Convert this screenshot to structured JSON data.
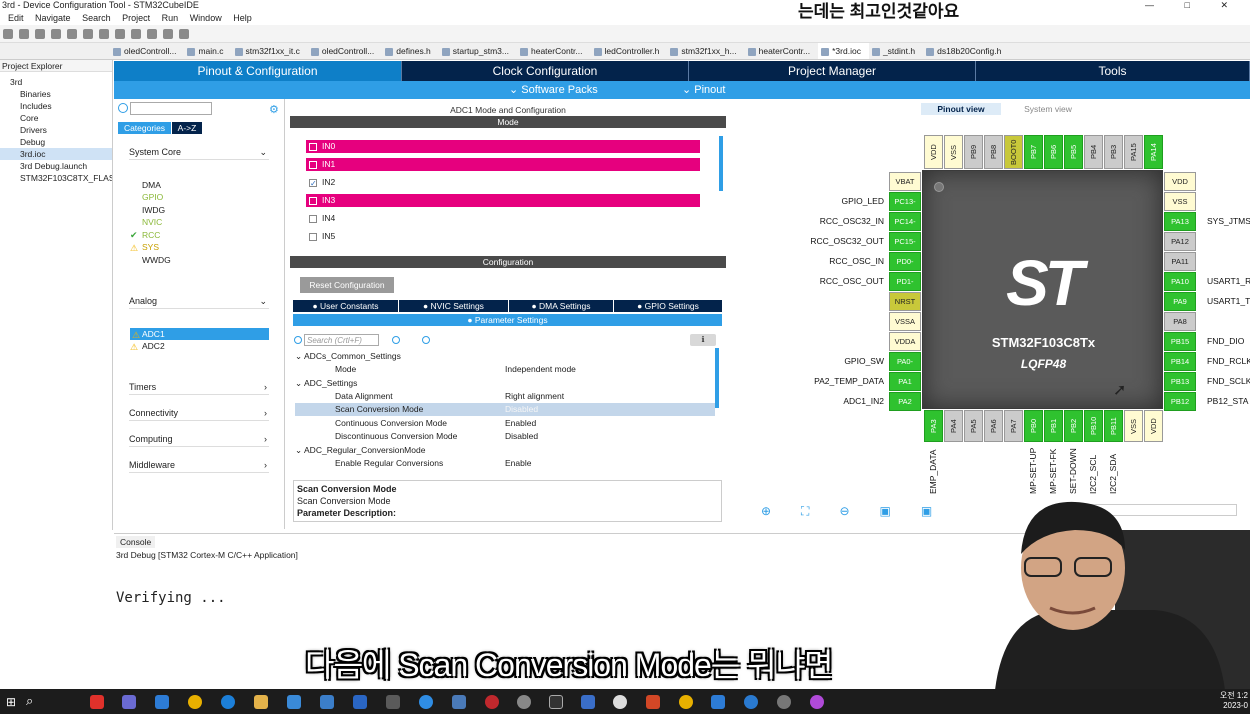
{
  "window": {
    "title": "3rd - Device Configuration Tool - STM32CubeIDE",
    "controls": "— □ ✕"
  },
  "subtitle_top": "는데는 최고인것같아요",
  "subtitle_bottom": "다음에 Scan Conversion Mode는 뭐냐면",
  "menu": [
    "Edit",
    "Navigate",
    "Search",
    "Project",
    "Run",
    "Window",
    "Help"
  ],
  "editor_tabs": [
    "oledControll...",
    "main.c",
    "stm32f1xx_it.c",
    "oledControll...",
    "defines.h",
    "startup_stm3...",
    "heaterContr...",
    "ledController.h",
    "stm32f1xx_h...",
    "heaterContr...",
    "*3rd.ioc",
    "_stdint.h",
    "ds18b20Config.h"
  ],
  "project_explorer": {
    "title": "Project Explorer",
    "items": [
      "3rd",
      "Binaries",
      "Includes",
      "Core",
      "Drivers",
      "Debug",
      "3rd.ioc",
      "3rd Debug.launch",
      "STM32F103C8TX_FLASH"
    ]
  },
  "main_tabs": [
    "Pinout & Configuration",
    "Clock Configuration",
    "Project Manager",
    "Tools"
  ],
  "sub_tabs": [
    "Software Packs",
    "Pinout"
  ],
  "categories": {
    "tab_categories": "Categories",
    "tab_az": "A->Z",
    "system_core": "System Core",
    "system_items": [
      "DMA",
      "GPIO",
      "IWDG",
      "NVIC",
      "RCC",
      "SYS",
      "WWDG"
    ],
    "analog": "Analog",
    "analog_items": [
      "ADC1",
      "ADC2"
    ],
    "sections": [
      "Timers",
      "Connectivity",
      "Computing",
      "Middleware"
    ]
  },
  "mode": {
    "title": "ADC1 Mode and Configuration",
    "header": "Mode",
    "inputs": [
      {
        "label": "IN0",
        "on": true
      },
      {
        "label": "IN1",
        "on": true
      },
      {
        "label": "IN2",
        "on": false,
        "checked": true
      },
      {
        "label": "IN3",
        "on": true
      },
      {
        "label": "IN4",
        "on": false
      },
      {
        "label": "IN5",
        "on": false
      }
    ]
  },
  "config": {
    "header": "Configuration",
    "reset_button": "Reset Configuration",
    "tabs": [
      "User Constants",
      "NVIC Settings",
      "DMA Settings",
      "GPIO Settings"
    ],
    "param_tab": "Parameter Settings",
    "search_placeholder": "Search (Crtl+F)",
    "params": [
      {
        "k": "ADCs_Common_Settings",
        "v": "",
        "indent": 0,
        "group": true
      },
      {
        "k": "Mode",
        "v": "Independent mode",
        "indent": 2
      },
      {
        "k": "ADC_Settings",
        "v": "",
        "indent": 0,
        "group": true
      },
      {
        "k": "Data Alignment",
        "v": "Right alignment",
        "indent": 2
      },
      {
        "k": "Scan Conversion Mode",
        "v": "Disabled",
        "indent": 2,
        "sel": true
      },
      {
        "k": "Continuous Conversion Mode",
        "v": "Enabled",
        "indent": 2
      },
      {
        "k": "Discontinuous Conversion Mode",
        "v": "Disabled",
        "indent": 2
      },
      {
        "k": "ADC_Regular_ConversionMode",
        "v": "",
        "indent": 0,
        "group": true
      },
      {
        "k": "Enable Regular Conversions",
        "v": "Enable",
        "indent": 2
      }
    ],
    "desc_title": "Scan Conversion Mode",
    "desc_sub": "Scan Conversion Mode",
    "desc_label": "Parameter Description:"
  },
  "pinout": {
    "view_tabs": [
      "Pinout view",
      "System view"
    ],
    "chip_name": "STM32F103C8Tx",
    "chip_pkg": "LQFP48",
    "logo": "ST",
    "top_pins": [
      "VDD",
      "VSS",
      "PB9",
      "PB8",
      "BOOT0",
      "PB7",
      "PB6",
      "PB5",
      "PB4",
      "PB3",
      "PA15",
      "PA14"
    ],
    "bottom_pins": [
      "PA3",
      "PA4",
      "PA5",
      "PA6",
      "PA7",
      "PB0",
      "PB1",
      "PB2",
      "PB10",
      "PB11",
      "VSS",
      "VDD"
    ],
    "left_pins": [
      "VBAT",
      "PC13-",
      "PC14-",
      "PC15-",
      "PD0-",
      "PD1-",
      "NRST",
      "VSSA",
      "VDDA",
      "PA0-",
      "PA1",
      "PA2"
    ],
    "right_pins": [
      "VDD",
      "VSS",
      "PA13",
      "PA12",
      "PA11",
      "PA10",
      "PA9",
      "PA8",
      "PB15",
      "PB14",
      "PB13",
      "PB12"
    ],
    "left_labels": [
      "",
      "GPIO_LED",
      "RCC_OSC32_IN",
      "RCC_OSC32_OUT",
      "RCC_OSC_IN",
      "RCC_OSC_OUT",
      "",
      "",
      "",
      "GPIO_SW",
      "PA2_TEMP_DATA",
      "ADC1_IN2"
    ],
    "right_labels": [
      "",
      "",
      "SYS_JTMS",
      "",
      "",
      "USART1_R",
      "USART1_T",
      "",
      "FND_DIO",
      "FND_RCLK",
      "FND_SCLK",
      "PB12_STA"
    ],
    "bottom_labels": [
      "EMP_DATA",
      "",
      "",
      "",
      "",
      "MP-SET-UP",
      "MP-SET-FK",
      "SET-DOWN",
      "I2C2_SCL",
      "I2C2_SDA",
      "",
      ""
    ]
  },
  "console": {
    "title": "Console",
    "launch": "3rd Debug [STM32 Cortex-M C/C++ Application]",
    "output": "Verifying ..."
  },
  "taskbar": {
    "time": "오전 1:2",
    "date": "2023-0"
  }
}
